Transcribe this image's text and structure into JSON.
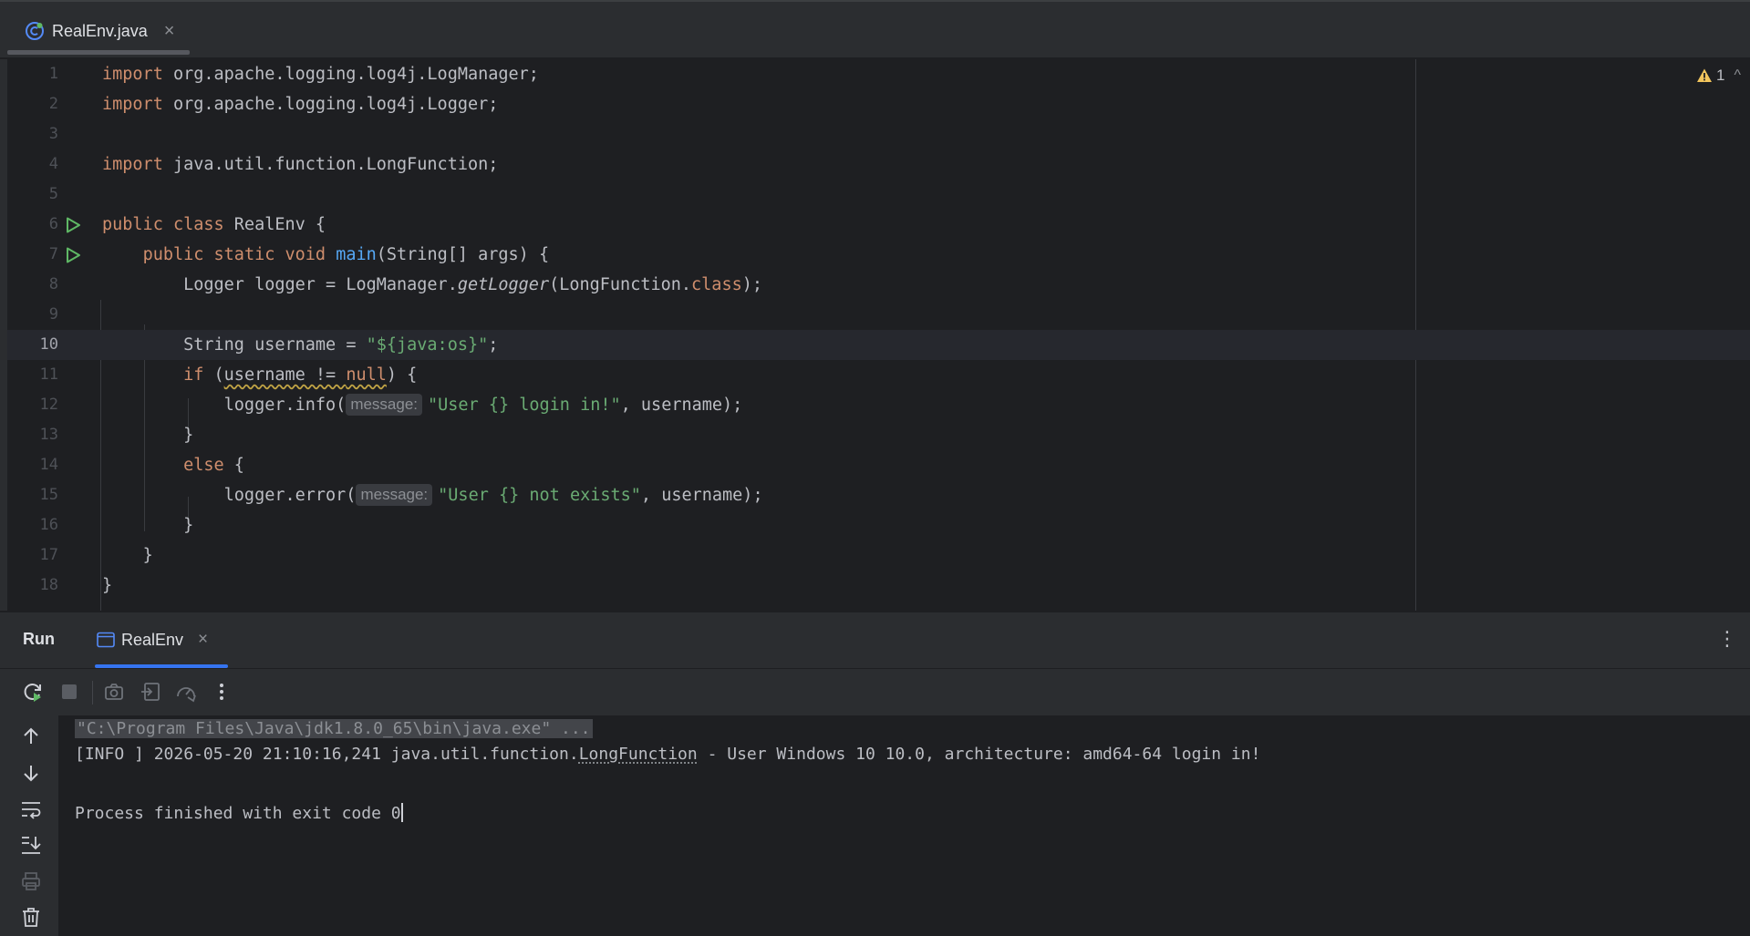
{
  "editor_tab": {
    "filename": "RealEnv.java",
    "close_label": "×"
  },
  "inspection": {
    "warning_count": "1",
    "chevron": "^"
  },
  "code": {
    "line_numbers": [
      "1",
      "2",
      "3",
      "4",
      "5",
      "6",
      "7",
      "8",
      "9",
      "10",
      "11",
      "12",
      "13",
      "14",
      "15",
      "16",
      "17",
      "18"
    ],
    "l1": {
      "kw": "import",
      "rest": " org.apache.logging.log4j.LogManager;"
    },
    "l2": {
      "kw": "import",
      "rest": " org.apache.logging.log4j.Logger;"
    },
    "l4": {
      "kw": "import",
      "rest": " java.util.function.LongFunction;"
    },
    "l6": {
      "kw1": "public",
      "kw2": " class",
      "rest": " RealEnv {"
    },
    "l7": {
      "kw": "public static void",
      "fn": "main",
      "rest": "(String[] args) {"
    },
    "l8": {
      "a": "Logger logger = LogManager.",
      "method": "getLogger",
      "b": "(LongFunction.",
      "kw": "class",
      "c": ");"
    },
    "l10": {
      "a": "String username = ",
      "str": "\"${java:os}\"",
      "b": ";"
    },
    "l11": {
      "kw": "if",
      "a": " (",
      "warn": "username != ",
      "kw2": "null",
      "b": ") {"
    },
    "l12": {
      "a": "logger.info(",
      "hint": "message:",
      "str": "\"User {} login in!\"",
      "b": ", username);"
    },
    "l13": {
      "a": "}"
    },
    "l14": {
      "kw": "else",
      "a": " {"
    },
    "l15": {
      "a": "logger.error(",
      "hint": "message:",
      "str": "\"User {} not exists\"",
      "b": ", username);"
    },
    "l16": {
      "a": "}"
    },
    "l17": {
      "a": "}"
    },
    "l18": {
      "a": "}"
    }
  },
  "run_panel": {
    "title": "Run",
    "tab_label": "RealEnv",
    "close_label": "×",
    "more_label": "⋮",
    "console": {
      "command": "\"C:\\Program Files\\Java\\jdk1.8.0_65\\bin\\java.exe\" ...",
      "log_prefix": "[INFO ] 2026-05-20 21:10:16,241 java.util.function.",
      "log_link": "LongFunction",
      "log_suffix": " - User Windows 10 10.0, architecture: amd64-64 login in!",
      "exit": "Process finished with exit code 0"
    }
  },
  "icons": {
    "file": "java-class-icon",
    "warning": "warning-icon",
    "run_gutter": "run-icon",
    "console_tab": "console-icon"
  },
  "colors": {
    "keyword": "#cf8e6d",
    "string": "#6aab73",
    "function": "#56a8f5",
    "accent": "#3574f0",
    "warning": "#f2c55c"
  }
}
